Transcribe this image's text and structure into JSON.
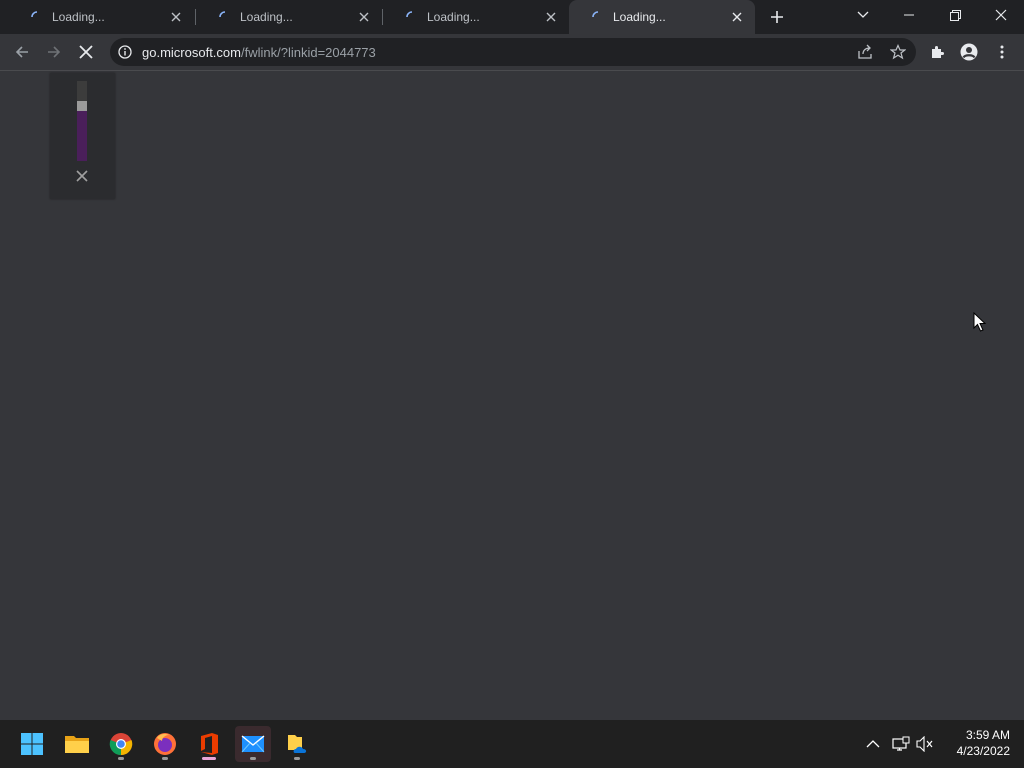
{
  "browser": {
    "tabs": [
      {
        "title": "Loading..."
      },
      {
        "title": "Loading..."
      },
      {
        "title": "Loading..."
      },
      {
        "title": "Loading...",
        "active": true
      }
    ],
    "address": {
      "host": "go.microsoft.com",
      "path": "/fwlink/?linkid=2044773"
    }
  },
  "volume_flyout": {
    "level_fraction": 0.75
  },
  "taskbar": {
    "apps": [
      "windows-start",
      "file-explorer",
      "chrome",
      "firefox",
      "office",
      "mail",
      "onedrive-files"
    ],
    "clock": {
      "time": "3:59 AM",
      "date": "4/23/2022"
    }
  },
  "colors": {
    "titlebar": "#202124",
    "toolbar": "#35363a",
    "taskbar": "#202020",
    "volume_accent": "#4a1f5a"
  }
}
